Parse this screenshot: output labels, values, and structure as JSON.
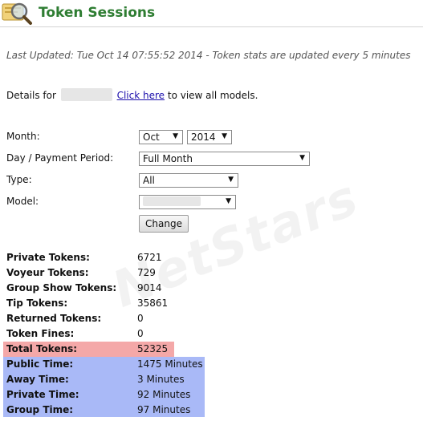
{
  "page": {
    "title": "Token Sessions",
    "last_updated": "Last Updated: Tue Oct 14 07:55:52 2014 - Token stats are updated every 5 minutes",
    "details_prefix": "Details for",
    "click_here": "Click here",
    "details_suffix": "to view all models."
  },
  "form": {
    "month_label": "Month:",
    "month_value": "Oct",
    "year_value": "2014",
    "period_label": "Day / Payment Period:",
    "period_value": "Full Month",
    "type_label": "Type:",
    "type_value": "All",
    "model_label": "Model:",
    "change_button": "Change"
  },
  "stats": [
    {
      "label": "Private Tokens:",
      "value": "6721"
    },
    {
      "label": "Voyeur Tokens:",
      "value": "729"
    },
    {
      "label": "Group Show Tokens:",
      "value": "9014"
    },
    {
      "label": "Tip Tokens:",
      "value": "35861"
    },
    {
      "label": "Returned Tokens:",
      "value": "0"
    },
    {
      "label": "Token Fines:",
      "value": "0"
    },
    {
      "label": "Total Tokens:",
      "value": "52325"
    },
    {
      "label": "Public Time:",
      "value": "1475 Minutes"
    },
    {
      "label": "Away Time:",
      "value": "3 Minutes"
    },
    {
      "label": "Private Time:",
      "value": "92 Minutes"
    },
    {
      "label": "Group Time:",
      "value": "97 Minutes"
    }
  ],
  "watermark": "NetStars",
  "colors": {
    "title": "#2e7d32",
    "highlight_total": "#f4a8a8",
    "highlight_time": "#a9b9f7",
    "link": "#1a0dab"
  }
}
